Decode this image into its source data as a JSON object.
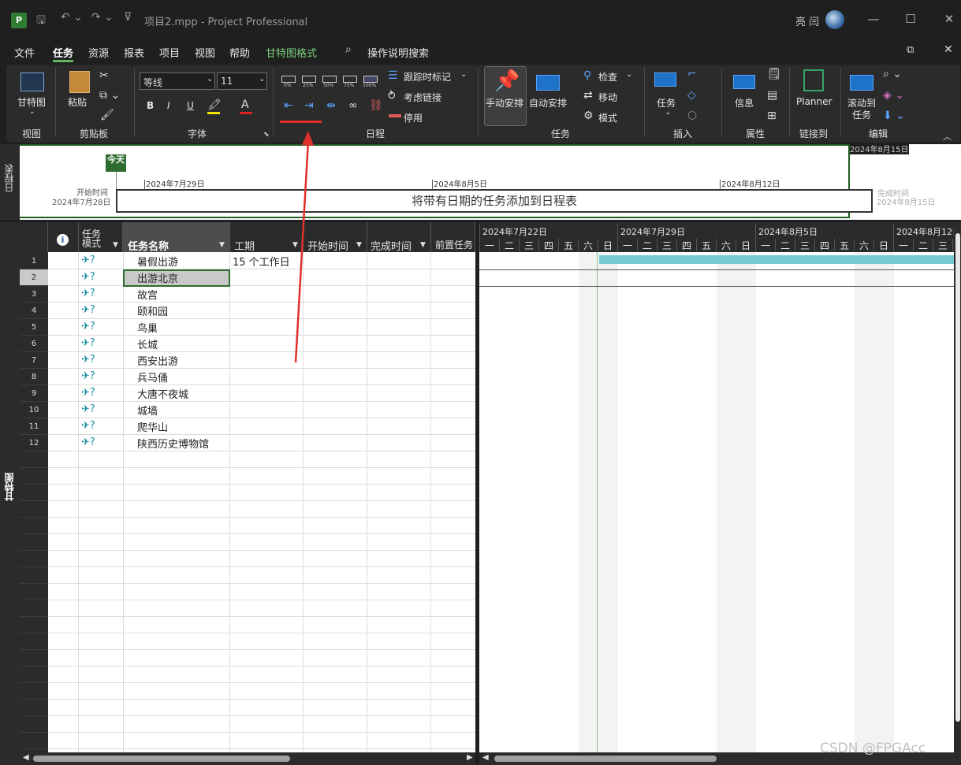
{
  "titlebar": {
    "doc_title": "项目2.mpp  -  Project Professional",
    "user_name": "亮 闫",
    "app_icon_letter": "P"
  },
  "menu": {
    "items": [
      "文件",
      "任务",
      "资源",
      "报表",
      "项目",
      "视图",
      "帮助",
      "甘特图格式"
    ],
    "active": "任务",
    "search_label": "操作说明搜索",
    "format_color": "#7ccf7c"
  },
  "ribbon": {
    "view_group": {
      "gantt_label": "甘特图",
      "label": "视图"
    },
    "clipboard_group": {
      "paste_label": "粘贴",
      "label": "剪贴板"
    },
    "font_group": {
      "font_name": "等线",
      "font_size": "11",
      "bold": "B",
      "italic": "I",
      "underline": "U",
      "label": "字体"
    },
    "schedule_group": {
      "percents": [
        "0%",
        "25%",
        "50%",
        "75%",
        "100%"
      ],
      "track_label": "跟踪时标记",
      "respect_links_label": "考虑链接",
      "inactivate_label": "停用",
      "label": "日程"
    },
    "tasks_group": {
      "manual_label": "手动安排",
      "auto_label": "自动安排",
      "inspect_label": "检查",
      "move_label": "移动",
      "mode_label": "模式",
      "label": "任务"
    },
    "insert_group": {
      "task_label": "任务",
      "label": "插入"
    },
    "properties_group": {
      "info_label": "信息",
      "label": "属性"
    },
    "links_group": {
      "planner_label": "Planner",
      "label": "链接到"
    },
    "editing_group": {
      "scroll_label": "滚动到",
      "scroll_label2": "任务",
      "label": "编辑"
    }
  },
  "timeline": {
    "side_label": "日程表",
    "today_label": "今天",
    "start_label": "开始时间",
    "start_date": "2024年7月28日",
    "finish_label": "完成时间",
    "finish_date": "2024年8月15日",
    "finish_date_top": "2024年8月15日",
    "ticks": [
      "2024年7月29日",
      "2024年8月5日",
      "2024年8月12日"
    ],
    "placeholder": "将带有日期的任务添加到日程表"
  },
  "gantt": {
    "side_label": "甘特图",
    "columns": {
      "mode": "任务模式",
      "name": "任务名称",
      "duration": "工期",
      "start": "开始时间",
      "finish": "完成时间",
      "predecessors": "前置任务"
    },
    "rows": [
      {
        "id": "1",
        "name": "暑假出游",
        "duration": "15 个工作日"
      },
      {
        "id": "2",
        "name": "出游北京",
        "duration": ""
      },
      {
        "id": "3",
        "name": "故宫",
        "duration": ""
      },
      {
        "id": "4",
        "name": "颐和园",
        "duration": ""
      },
      {
        "id": "5",
        "name": "鸟巢",
        "duration": ""
      },
      {
        "id": "6",
        "name": "长城",
        "duration": ""
      },
      {
        "id": "7",
        "name": "西安出游",
        "duration": ""
      },
      {
        "id": "8",
        "name": "兵马俑",
        "duration": ""
      },
      {
        "id": "9",
        "name": "大唐不夜城",
        "duration": ""
      },
      {
        "id": "10",
        "name": "城墙",
        "duration": ""
      },
      {
        "id": "11",
        "name": "爬华山",
        "duration": ""
      },
      {
        "id": "12",
        "name": "陕西历史博物馆",
        "duration": ""
      }
    ],
    "selected_row": "2",
    "weeks": [
      "2024年7月22日",
      "2024年7月29日",
      "2024年8月5日",
      "2024年8月12日"
    ],
    "days": [
      "一",
      "二",
      "三",
      "四",
      "五",
      "六",
      "日"
    ],
    "bar_color": "#76cbd3"
  },
  "watermark": "CSDN @FPGAcc"
}
